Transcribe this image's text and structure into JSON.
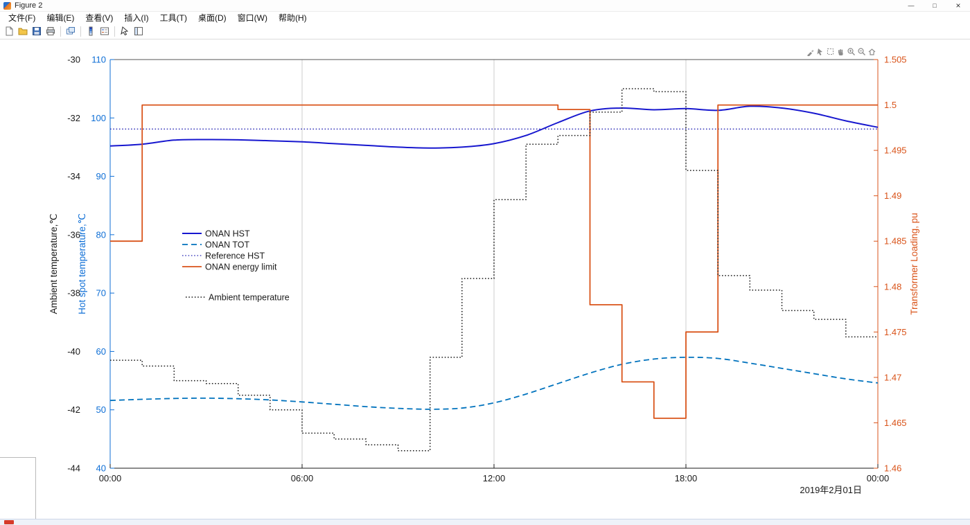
{
  "window": {
    "title": "Figure 2",
    "controls": {
      "minimize": "—",
      "maximize": "□",
      "close": "×"
    }
  },
  "menu": {
    "items": [
      "文件(F)",
      "编辑(E)",
      "查看(V)",
      "插入(I)",
      "工具(T)",
      "桌面(D)",
      "窗口(W)",
      "帮助(H)"
    ]
  },
  "toolbar": {
    "buttons": [
      "new-figure",
      "open-file",
      "save-figure",
      "print-figure",
      "link-plot",
      "insert-colorbar",
      "insert-legend",
      "edit-plot",
      "plot-browser"
    ]
  },
  "axes_toolbar": {
    "buttons": [
      "brush",
      "data-tips",
      "selection",
      "pan",
      "zoom-in",
      "zoom-out",
      "restore-view"
    ]
  },
  "chart_data": {
    "type": "line",
    "x_range": [
      0,
      24
    ],
    "x_ticks": {
      "hours": [
        0,
        6,
        12,
        18,
        24
      ],
      "labels": [
        "00:00",
        "06:00",
        "12:00",
        "18:00",
        "00:00"
      ]
    },
    "date_label": "2019年2月01日",
    "grid": "vertical-only",
    "axes": {
      "ambient": {
        "label": "Ambient temperature,℃",
        "range": [
          -44,
          -30
        ],
        "ticks": [
          -44,
          -42,
          -40,
          -38,
          -36,
          -34,
          -32,
          -30
        ],
        "color": "#1a1a1a"
      },
      "hotspot": {
        "label": "Hot spot temperature,℃",
        "range": [
          40,
          110
        ],
        "ticks": [
          40,
          50,
          60,
          70,
          80,
          90,
          100,
          110
        ],
        "color": "#0D6ED6"
      },
      "loading": {
        "label": "Transformer Loading, pu",
        "range": [
          1.46,
          1.505
        ],
        "ticks": [
          1.46,
          1.465,
          1.47,
          1.475,
          1.48,
          1.485,
          1.49,
          1.495,
          1.5,
          1.505
        ],
        "color": "#D95319"
      }
    },
    "series": [
      {
        "name": "ONAN HST",
        "axis": "hotspot",
        "style": "solid",
        "color": "#1717CF",
        "width": 2,
        "values": [
          95.2,
          95.5,
          96.2,
          96.3,
          96.25,
          96.1,
          95.9,
          95.6,
          95.3,
          95.0,
          94.85,
          95.0,
          95.6,
          97.0,
          99.2,
          101.2,
          101.7,
          101.4,
          101.6,
          101.3,
          102.0,
          101.7,
          100.8,
          99.5,
          98.4
        ]
      },
      {
        "name": "ONAN TOT",
        "axis": "hotspot",
        "style": "dashed",
        "color": "#0072BD",
        "width": 1.8,
        "values": [
          51.6,
          51.8,
          51.95,
          52.0,
          51.9,
          51.7,
          51.35,
          50.95,
          50.55,
          50.25,
          50.1,
          50.3,
          51.2,
          52.7,
          54.5,
          56.3,
          57.8,
          58.7,
          59.0,
          58.8,
          58.0,
          57.1,
          56.2,
          55.3,
          54.6
        ]
      },
      {
        "name": "Reference HST",
        "axis": "hotspot",
        "style": "dotted",
        "color": "#2323B4",
        "width": 1.3,
        "x": [
          0,
          24
        ],
        "values": [
          98.1,
          98.1
        ]
      },
      {
        "name": "ONAN energy limit",
        "axis": "loading",
        "style": "solid",
        "stairs": true,
        "color": "#D95319",
        "width": 1.8,
        "steps": [
          [
            0,
            1.485
          ],
          [
            1,
            1.5
          ],
          [
            14,
            1.4995
          ],
          [
            15,
            1.478
          ],
          [
            16,
            1.4695
          ],
          [
            17,
            1.4655
          ],
          [
            18,
            1.475
          ],
          [
            19,
            1.5
          ]
        ]
      },
      {
        "name": "Ambient temperature",
        "axis": "ambient",
        "style": "dotted",
        "stairs": true,
        "color": "#1a1a1a",
        "width": 1.5,
        "values": [
          -40.3,
          -40.5,
          -41.0,
          -41.1,
          -41.5,
          -42.0,
          -42.8,
          -43.0,
          -43.2,
          -43.4,
          -40.2,
          -37.5,
          -34.8,
          -32.9,
          -32.6,
          -31.8,
          -31.0,
          -31.1,
          -33.8,
          -37.4,
          -37.9,
          -38.6,
          -38.9,
          -39.5
        ]
      }
    ],
    "legend1": [
      "ONAN HST",
      "ONAN TOT",
      "Reference HST",
      "ONAN energy limit"
    ],
    "legend2": [
      "Ambient temperature"
    ]
  }
}
